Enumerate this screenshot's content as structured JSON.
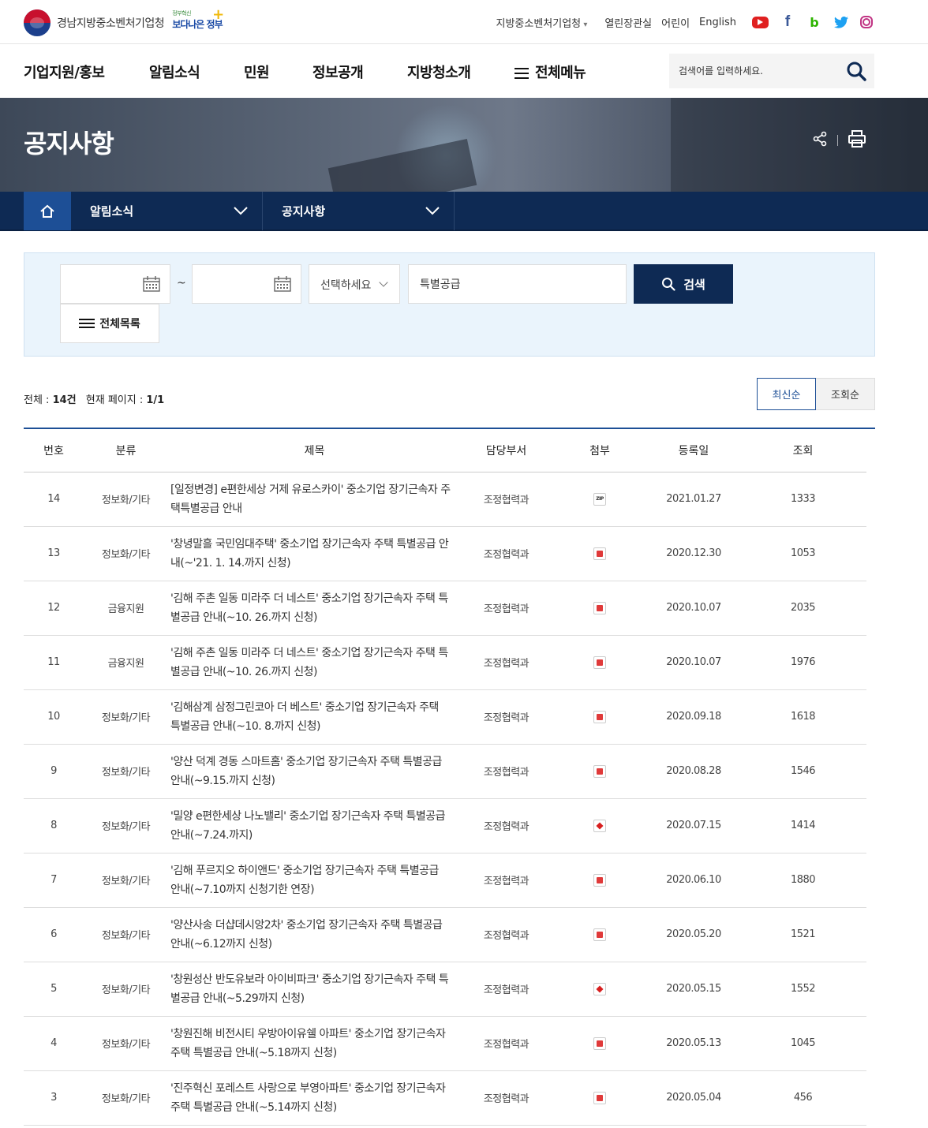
{
  "header": {
    "org_name": "경남지방중소벤처기업청",
    "slogan_small": "정부혁신",
    "slogan_big": "보다나은 정부",
    "util_links": [
      "지방중소벤처기업청",
      "열린장관실",
      "어린이",
      "English"
    ],
    "sns": [
      "youtube-icon",
      "facebook-icon",
      "blog-icon",
      "twitter-icon",
      "instagram-icon"
    ]
  },
  "gnb": {
    "items": [
      "기업지원/홍보",
      "알림소식",
      "민원",
      "정보공개",
      "지방청소개",
      "전체메뉴"
    ],
    "search_placeholder": "검색어를 입력하세요."
  },
  "banner": {
    "title": "공지사항"
  },
  "location": {
    "depth1": "알림소식",
    "depth2": "공지사항"
  },
  "filter": {
    "date_separator": "~",
    "select_value": "선택하세요",
    "keyword": "특별공급",
    "search_label": "검색",
    "list_all_label": "전체목록"
  },
  "list_info": {
    "total_label": "전체 : ",
    "total_value": "14건",
    "page_label": "현재 페이지 : ",
    "page_value": "1/1"
  },
  "sort": {
    "latest": "최신순",
    "views": "조회순"
  },
  "table": {
    "headers": [
      "번호",
      "분류",
      "제목",
      "담당부서",
      "첨부",
      "등록일",
      "조회"
    ],
    "rows": [
      {
        "no": "14",
        "cat": "정보화/기타",
        "title": "[일정변경] e편한세상 거제 유로스카이' 중소기업 장기근속자 주택특별공급 안내",
        "dept": "조정협력과",
        "att": "zip",
        "att_label": "ZIP",
        "date": "2021.01.27",
        "views": "1333"
      },
      {
        "no": "13",
        "cat": "정보화/기타",
        "title": "'창녕말흘 국민임대주택' 중소기업 장기근속자 주택 특별공급 안내(~'21. 1. 14.까지 신청)",
        "dept": "조정협력과",
        "att": "hwp",
        "att_label": "",
        "date": "2020.12.30",
        "views": "1053"
      },
      {
        "no": "12",
        "cat": "금융지원",
        "title": "'김해 주촌 일동 미라주 더 네스트' 중소기업 장기근속자 주택 특별공급 안내(~10. 26.까지 신청)",
        "dept": "조정협력과",
        "att": "hwp",
        "att_label": "",
        "date": "2020.10.07",
        "views": "2035"
      },
      {
        "no": "11",
        "cat": "금융지원",
        "title": "'김해 주촌 일동 미라주 더 네스트' 중소기업 장기근속자 주택 특별공급 안내(~10. 26.까지 신청)",
        "dept": "조정협력과",
        "att": "hwp",
        "att_label": "",
        "date": "2020.10.07",
        "views": "1976"
      },
      {
        "no": "10",
        "cat": "정보화/기타",
        "title": "'김해삼계 삼정그린코아 더 베스트' 중소기업 장기근속자 주택 특별공급 안내(~10. 8.까지 신청)",
        "dept": "조정협력과",
        "att": "hwp",
        "att_label": "",
        "date": "2020.09.18",
        "views": "1618"
      },
      {
        "no": "9",
        "cat": "정보화/기타",
        "title": "'양산 덕계 경동 스마트홈' 중소기업 장기근속자 주택 특별공급 안내(~9.15.까지 신청)",
        "dept": "조정협력과",
        "att": "hwp",
        "att_label": "",
        "date": "2020.08.28",
        "views": "1546"
      },
      {
        "no": "8",
        "cat": "정보화/기타",
        "title": "'밀양 e편한세상 나노밸리' 중소기업 장기근속자 주택 특별공급 안내(~7.24.까지)",
        "dept": "조정협력과",
        "att": "pdf",
        "att_label": "",
        "date": "2020.07.15",
        "views": "1414"
      },
      {
        "no": "7",
        "cat": "정보화/기타",
        "title": "'김해 푸르지오 하이앤드' 중소기업 장기근속자 주택 특별공급 안내(~7.10까지 신청기한 연장)",
        "dept": "조정협력과",
        "att": "hwp",
        "att_label": "",
        "date": "2020.06.10",
        "views": "1880"
      },
      {
        "no": "6",
        "cat": "정보화/기타",
        "title": "'양산사송 더샵데시앙2차' 중소기업 장기근속자 주택 특별공급 안내(~6.12까지 신청)",
        "dept": "조정협력과",
        "att": "hwp",
        "att_label": "",
        "date": "2020.05.20",
        "views": "1521"
      },
      {
        "no": "5",
        "cat": "정보화/기타",
        "title": "'창원성산 반도유보라 아이비파크' 중소기업 장기근속자 주택 특별공급 안내(~5.29까지 신청)",
        "dept": "조정협력과",
        "att": "pdf",
        "att_label": "",
        "date": "2020.05.15",
        "views": "1552"
      },
      {
        "no": "4",
        "cat": "정보화/기타",
        "title": "'창원진해 비전시티 우방아이유쉘 아파트' 중소기업 장기근속자 주택 특별공급 안내(~5.18까지 신청)",
        "dept": "조정협력과",
        "att": "hwp",
        "att_label": "",
        "date": "2020.05.13",
        "views": "1045"
      },
      {
        "no": "3",
        "cat": "정보화/기타",
        "title": "'진주혁신 포레스트 사랑으로 부영아파트' 중소기업 장기근속자 주택 특별공급 안내(~5.14까지 신청)",
        "dept": "조정협력과",
        "att": "hwp",
        "att_label": "",
        "date": "2020.05.04",
        "views": "456"
      }
    ]
  },
  "colors": {
    "navy": "#0e2a54",
    "accent_blue": "#1d4f96",
    "filter_bg": "#eaf4fc"
  }
}
